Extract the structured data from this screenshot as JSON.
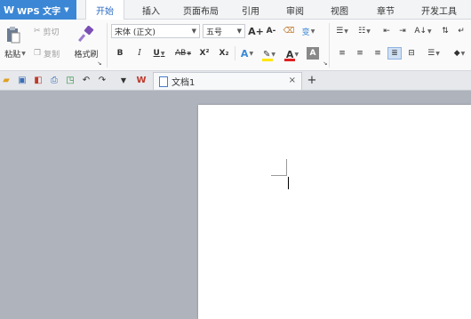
{
  "app": {
    "logo": "W",
    "label": "WPS 文字"
  },
  "tabs": [
    "开始",
    "插入",
    "页面布局",
    "引用",
    "审阅",
    "视图",
    "章节",
    "开发工具"
  ],
  "active_tab": "开始",
  "ribbon": {
    "paste": "粘贴",
    "cut": "剪切",
    "copy": "复制",
    "format_painter": "格式刷",
    "font_name": "宋体 (正文)",
    "font_size": "五号",
    "bold": "B",
    "italic": "I",
    "underline": "U",
    "strikethrough": "AB",
    "superscript": "X²",
    "subscript": "X₂",
    "grow_font": "A+",
    "shrink_font": "A-",
    "font_color": "A",
    "char_shading": "A",
    "text_effect": "A",
    "phonetic": "变"
  },
  "doc_tab": {
    "title": "文档1",
    "close": "×",
    "new_tab": "+"
  },
  "colors": {
    "accent": "#3b87d6",
    "font_color_bar": "#e02020",
    "highlight_bar": "#ffe600"
  }
}
